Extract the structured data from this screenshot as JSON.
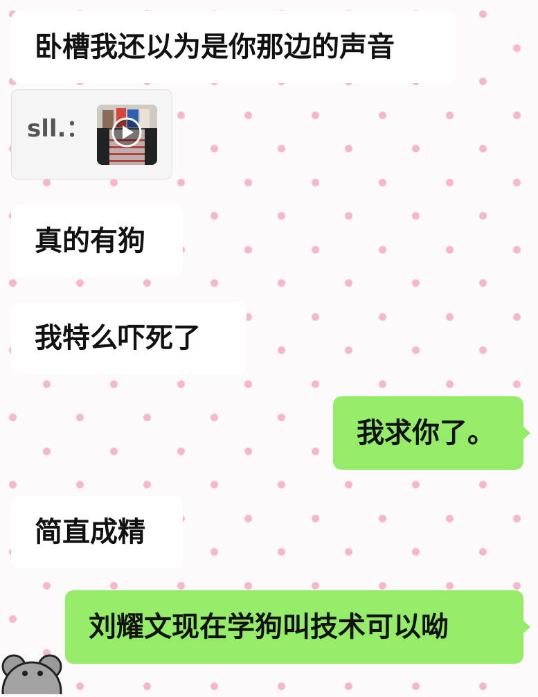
{
  "messages": [
    {
      "id": "m1",
      "direction": "in",
      "text": "卧槽我还以为是你那边的声音"
    },
    {
      "id": "m2",
      "direction": "in",
      "type": "quote",
      "sender": "sll.：",
      "attachment": "video-thumbnail"
    },
    {
      "id": "m3",
      "direction": "in",
      "text": "真的有狗"
    },
    {
      "id": "m4",
      "direction": "in",
      "text": "我特么吓死了"
    },
    {
      "id": "m5",
      "direction": "out",
      "text": "我求你了。"
    },
    {
      "id": "m6",
      "direction": "in",
      "text": "简直成精"
    },
    {
      "id": "m7",
      "direction": "out",
      "text": "刘耀文现在学狗叫技术可以呦"
    }
  ],
  "theme": {
    "incoming_bubble": "#ffffff",
    "outgoing_bubble": "#95ec69",
    "background_dots": "#f4b7cf"
  },
  "icons": {
    "play": "play-icon",
    "avatar": "gray-bear-avatar"
  }
}
